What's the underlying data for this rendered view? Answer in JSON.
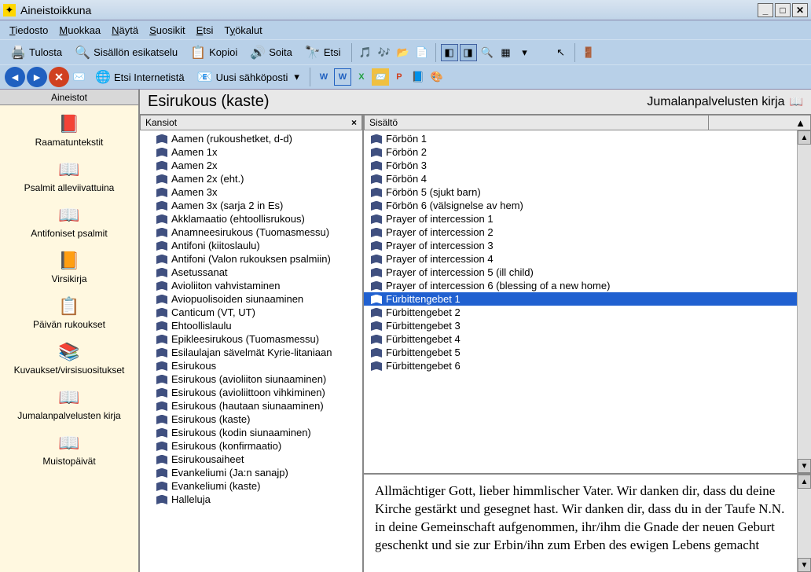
{
  "window": {
    "title": "Aineistoikkuna"
  },
  "menu": {
    "file": "Tiedosto",
    "edit": "Muokkaa",
    "view": "Näytä",
    "favorites": "Suosikit",
    "search": "Etsi",
    "tools": "Työkalut"
  },
  "toolbar1": {
    "print": "Tulosta",
    "preview": "Sisällön esikatselu",
    "copy": "Kopioi",
    "play": "Soita",
    "find": "Etsi"
  },
  "toolbar2": {
    "search_internet": "Etsi Internetistä",
    "new_email": "Uusi sähköposti"
  },
  "sidebar": {
    "header": "Aineistot",
    "items": [
      {
        "label": "Raamatuntekstit",
        "icon": "📕"
      },
      {
        "label": "Psalmit alleviivattuina",
        "icon": "📖"
      },
      {
        "label": "Antifoniset psalmit",
        "icon": "📖"
      },
      {
        "label": "Virsikirja",
        "icon": "📙"
      },
      {
        "label": "Päivän rukoukset",
        "icon": "📋"
      },
      {
        "label": "Kuvaukset/virsisuositukset",
        "icon": "📚"
      },
      {
        "label": "Jumalanpalvelusten kirja",
        "icon": "📖"
      },
      {
        "label": "Muistopäivät",
        "icon": "📖"
      }
    ]
  },
  "content": {
    "title": "Esirukous (kaste)",
    "subtitle": "Jumalanpalvelusten kirja"
  },
  "folders": {
    "header": "Kansiot",
    "items": [
      "Aamen (rukoushetket, d-d)",
      "Aamen 1x",
      "Aamen 2x",
      "Aamen 2x (eht.)",
      "Aamen 3x",
      "Aamen 3x (sarja 2 in Es)",
      "Akklamaatio (ehtoollisrukous)",
      "Anamneesirukous (Tuomasmessu)",
      "Antifoni (kiitoslaulu)",
      "Antifoni (Valon rukouksen psalmiin)",
      "Asetussanat",
      "Avioliiton vahvistaminen",
      "Aviopuolisoiden siunaaminen",
      "Canticum (VT, UT)",
      "Ehtoollislaulu",
      "Epikleesirukous (Tuomasmessu)",
      "Esilaulajan sävelmät Kyrie-litaniaan",
      "Esirukous",
      "Esirukous (avioliiton siunaaminen)",
      "Esirukous (avioliittoon vihkiminen)",
      "Esirukous (hautaan siunaaminen)",
      "Esirukous (kaste)",
      "Esirukous (kodin siunaaminen)",
      "Esirukous (konfirmaatio)",
      "Esirukousaiheet",
      "Evankeliumi (Ja:n sanajp)",
      "Evankeliumi (kaste)",
      "Halleluja"
    ]
  },
  "sisalto": {
    "header": "Sisältö",
    "items": [
      {
        "label": "Förbön 1",
        "selected": false
      },
      {
        "label": "Förbön 2",
        "selected": false
      },
      {
        "label": "Förbön 3",
        "selected": false
      },
      {
        "label": "Förbön 4",
        "selected": false
      },
      {
        "label": "Förbön 5 (sjukt barn)",
        "selected": false
      },
      {
        "label": "Förbön 6 (välsignelse av hem)",
        "selected": false
      },
      {
        "label": "Prayer of intercession 1",
        "selected": false
      },
      {
        "label": "Prayer of intercession 2",
        "selected": false
      },
      {
        "label": "Prayer of intercession 3",
        "selected": false
      },
      {
        "label": "Prayer of intercession 4",
        "selected": false
      },
      {
        "label": "Prayer of intercession 5 (ill child)",
        "selected": false
      },
      {
        "label": "Prayer of intercession 6 (blessing of a new home)",
        "selected": false
      },
      {
        "label": "Fürbittengebet 1",
        "selected": true
      },
      {
        "label": "Fürbittengebet 2",
        "selected": false
      },
      {
        "label": "Fürbittengebet 3",
        "selected": false
      },
      {
        "label": "Fürbittengebet 4",
        "selected": false
      },
      {
        "label": "Fürbittengebet 5",
        "selected": false
      },
      {
        "label": "Fürbittengebet 6",
        "selected": false
      }
    ]
  },
  "text": "Allmächtiger Gott, lieber himmlischer Vater. Wir danken dir, dass du deine Kirche gestärkt und gesegnet hast. Wir danken dir, dass du in der Taufe N.N. in deine Gemeinschaft aufgenommen, ihr/ihm die Gnade der neuen Geburt geschenkt und sie zur Erbin/ihn zum Erben des ewigen Lebens gemacht"
}
